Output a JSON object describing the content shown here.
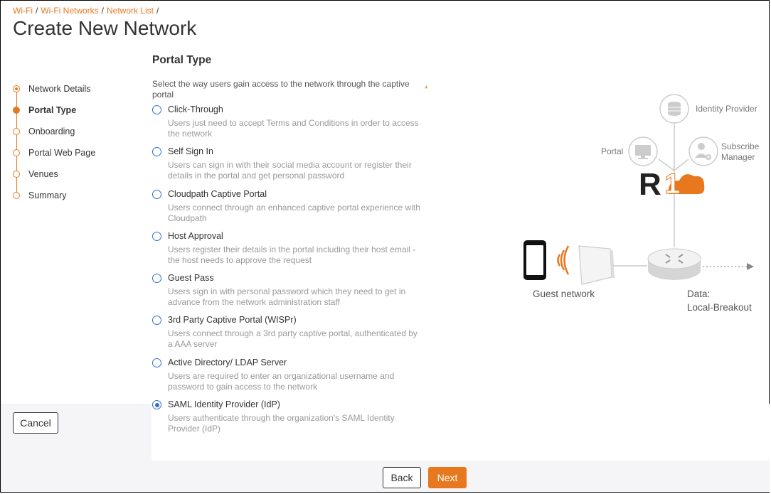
{
  "breadcrumb": [
    "Wi-Fi",
    "Wi-Fi Networks",
    "Network List"
  ],
  "page_title": "Create New Network",
  "steps": [
    {
      "label": "Network Details",
      "state": "done"
    },
    {
      "label": "Portal Type",
      "state": "active"
    },
    {
      "label": "Onboarding",
      "state": "todo"
    },
    {
      "label": "Portal Web Page",
      "state": "todo"
    },
    {
      "label": "Venues",
      "state": "todo"
    },
    {
      "label": "Summary",
      "state": "todo"
    }
  ],
  "section_title": "Portal Type",
  "instructions": "Select the way users gain access to the network through the captive portal",
  "required_mark": "*",
  "options": [
    {
      "title": "Click-Through",
      "desc": "Users just need to accept Terms and Conditions in order to access the network",
      "checked": false
    },
    {
      "title": "Self Sign In",
      "desc": "Users can sign in with their social media account or register their details in the portal and get personal password",
      "checked": false
    },
    {
      "title": "Cloudpath Captive Portal",
      "desc": "Users connect through an enhanced captive portal experience with Cloudpath",
      "checked": false
    },
    {
      "title": "Host Approval",
      "desc": "Users register their details in the portal including their host email - the host needs to approve the request",
      "checked": false
    },
    {
      "title": "Guest Pass",
      "desc": "Users sign in with personal password which they need to get in advance from the network administration staff",
      "checked": false
    },
    {
      "title": "3rd Party Captive Portal (WISPr)",
      "desc": "Users connect through a 3rd party captive portal, authenticated by a AAA server",
      "checked": false
    },
    {
      "title": "Active Directory/ LDAP Server",
      "desc": "Users are required to enter an organizational username and password to gain access to the network",
      "checked": false
    },
    {
      "title": "SAML Identity Provider (IdP)",
      "desc": "Users authenticate through the organization's SAML Identity Provider (IdP)",
      "checked": true
    }
  ],
  "buttons": {
    "cancel": "Cancel",
    "back": "Back",
    "next": "Next"
  },
  "diagram": {
    "identity_provider": "Identity Provider",
    "portal": "Portal",
    "subscribe_manager_1": "Subscribe",
    "subscribe_manager_2": "Manager",
    "logo": "R1",
    "guest_network": "Guest network",
    "data_1": "Data:",
    "data_2": "Local-Breakout"
  },
  "colors": {
    "accent": "#e8781e",
    "radio": "#2e6fd0"
  }
}
